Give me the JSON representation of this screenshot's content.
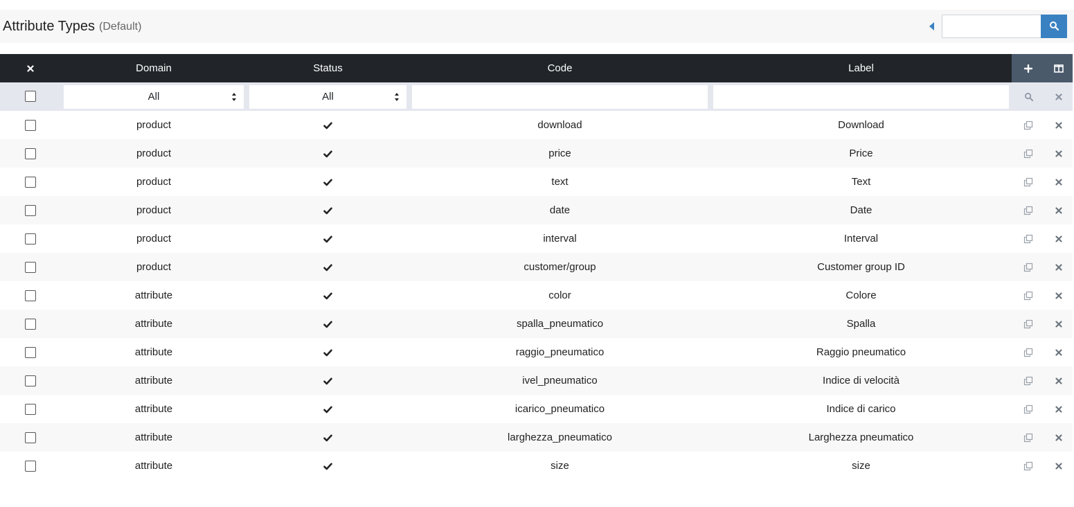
{
  "header": {
    "title": "Attribute Types",
    "subtitle": "(Default)",
    "search_value": ""
  },
  "columns": [
    "Domain",
    "Status",
    "Code",
    "Label"
  ],
  "filters": {
    "domain": "All",
    "status": "All",
    "code": "",
    "label": ""
  },
  "icons": {
    "search": "search-icon",
    "toggle": "caret-left-icon",
    "add": "plus-icon",
    "columns": "columns-icon",
    "clear": "times-icon",
    "copy": "copy-icon",
    "delete": "times-icon",
    "status_ok": "check-icon"
  },
  "colors": {
    "header_bg": "#212529",
    "action_header_bg": "#4b5a6b",
    "filter_bg": "#e4e7ee",
    "accent": "#3a81c2"
  },
  "rows": [
    {
      "domain": "product",
      "status": "enabled",
      "code": "download",
      "label": "Download"
    },
    {
      "domain": "product",
      "status": "enabled",
      "code": "price",
      "label": "Price"
    },
    {
      "domain": "product",
      "status": "enabled",
      "code": "text",
      "label": "Text"
    },
    {
      "domain": "product",
      "status": "enabled",
      "code": "date",
      "label": "Date"
    },
    {
      "domain": "product",
      "status": "enabled",
      "code": "interval",
      "label": "Interval"
    },
    {
      "domain": "product",
      "status": "enabled",
      "code": "customer/group",
      "label": "Customer group ID"
    },
    {
      "domain": "attribute",
      "status": "enabled",
      "code": "color",
      "label": "Colore"
    },
    {
      "domain": "attribute",
      "status": "enabled",
      "code": "spalla_pneumatico",
      "label": "Spalla"
    },
    {
      "domain": "attribute",
      "status": "enabled",
      "code": "raggio_pneumatico",
      "label": "Raggio pneumatico"
    },
    {
      "domain": "attribute",
      "status": "enabled",
      "code": "ivel_pneumatico",
      "label": "Indice di velocità"
    },
    {
      "domain": "attribute",
      "status": "enabled",
      "code": "icarico_pneumatico",
      "label": "Indice di carico"
    },
    {
      "domain": "attribute",
      "status": "enabled",
      "code": "larghezza_pneumatico",
      "label": "Larghezza pneumatico"
    },
    {
      "domain": "attribute",
      "status": "enabled",
      "code": "size",
      "label": "size"
    }
  ]
}
